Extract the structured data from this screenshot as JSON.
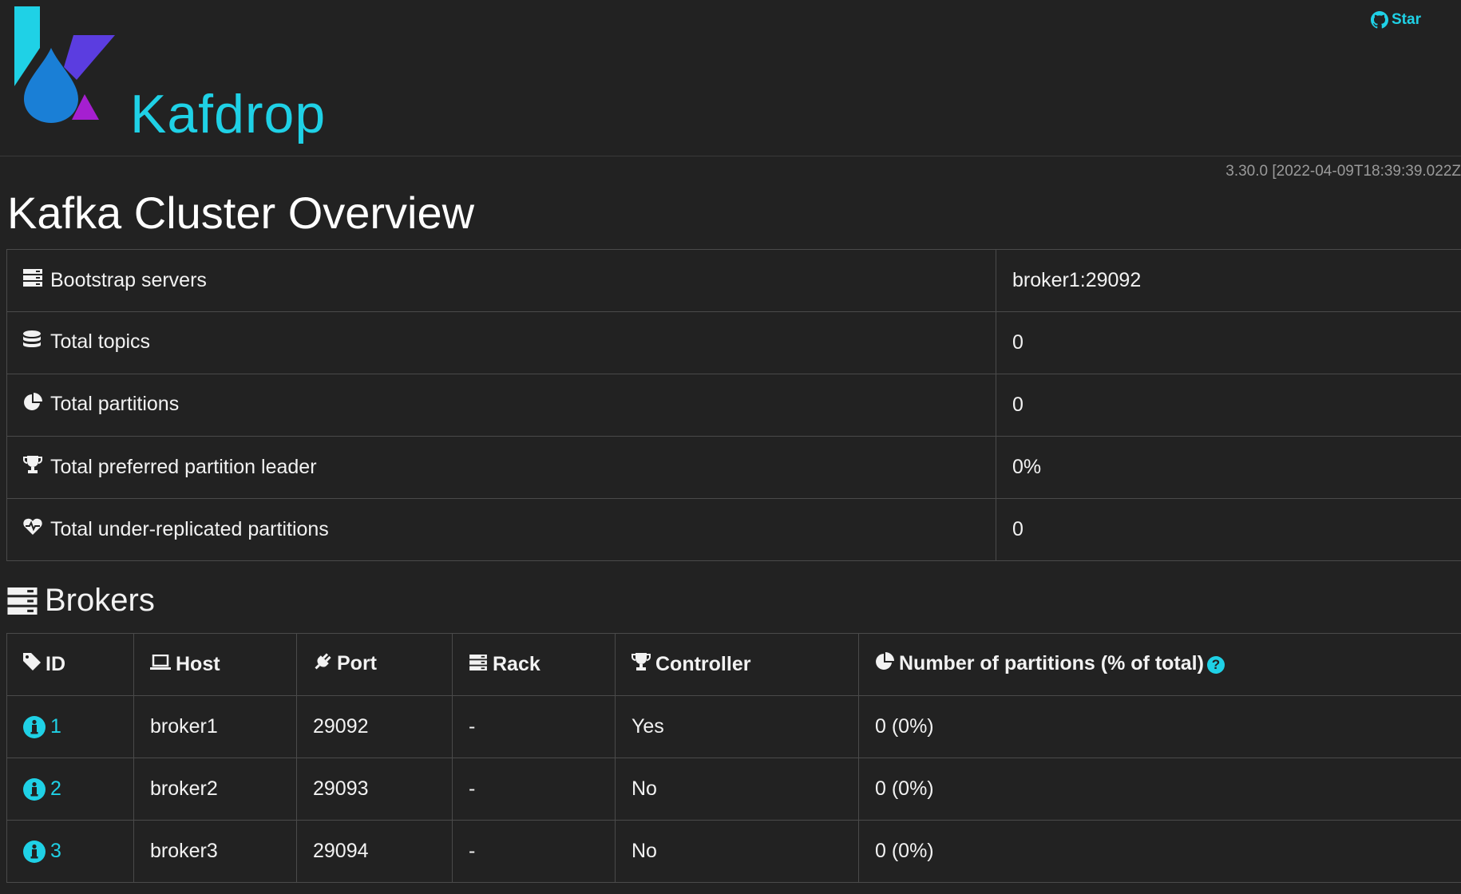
{
  "app": {
    "brand": "Kafdrop",
    "github_star": "Star",
    "version": "3.30.0 [2022-04-09T18:39:39.022Z"
  },
  "page": {
    "title": "Kafka Cluster Overview"
  },
  "overview": {
    "rows": [
      {
        "icon": "server-icon",
        "label": "Bootstrap servers",
        "value": "broker1:29092"
      },
      {
        "icon": "database-icon",
        "label": "Total topics",
        "value": "0"
      },
      {
        "icon": "pie-chart-icon",
        "label": "Total partitions",
        "value": "0"
      },
      {
        "icon": "trophy-icon",
        "label": "Total preferred partition leader",
        "value": "0%"
      },
      {
        "icon": "heartbeat-icon",
        "label": "Total under-replicated partitions",
        "value": "0"
      }
    ]
  },
  "brokers": {
    "title": "Brokers",
    "columns": {
      "id": "ID",
      "host": "Host",
      "port": "Port",
      "rack": "Rack",
      "controller": "Controller",
      "partitions": "Number of partitions (% of total)"
    },
    "rows": [
      {
        "id": "1",
        "host": "broker1",
        "port": "29092",
        "rack": "-",
        "controller": "Yes",
        "partitions": "0 (0%)"
      },
      {
        "id": "2",
        "host": "broker2",
        "port": "29093",
        "rack": "-",
        "controller": "No",
        "partitions": "0 (0%)"
      },
      {
        "id": "3",
        "host": "broker3",
        "port": "29094",
        "rack": "-",
        "controller": "No",
        "partitions": "0 (0%)"
      }
    ]
  },
  "colors": {
    "accent": "#1fd1e6",
    "background": "#222222",
    "logo_blue": "#1a7fd6",
    "logo_purple": "#5b3de0",
    "logo_magenta": "#a51fd0"
  }
}
